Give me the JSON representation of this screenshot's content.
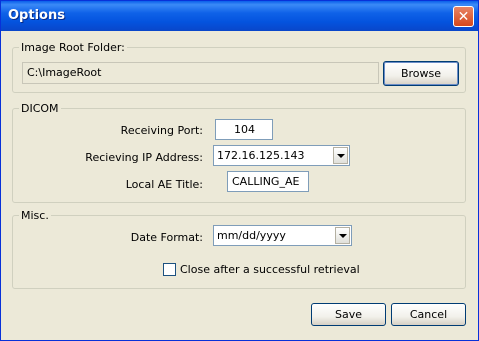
{
  "window": {
    "title": "Options"
  },
  "image_root": {
    "legend": "Image Root Folder:",
    "path": "C:\\ImageRoot",
    "browse_label": "Browse"
  },
  "dicom": {
    "legend": "DICOM",
    "port_label": "Receiving Port:",
    "port_value": "104",
    "ip_label": "Recieving IP Address:",
    "ip_value": "172.16.125.143",
    "ae_label": "Local AE Title:",
    "ae_value": "CALLING_AE"
  },
  "misc": {
    "legend": "Misc.",
    "date_format_label": "Date Format:",
    "date_format_value": "mm/dd/yyyy",
    "close_after_label": "Close after a successful retrieval",
    "close_after_checked": false
  },
  "footer": {
    "save_label": "Save",
    "cancel_label": "Cancel"
  }
}
